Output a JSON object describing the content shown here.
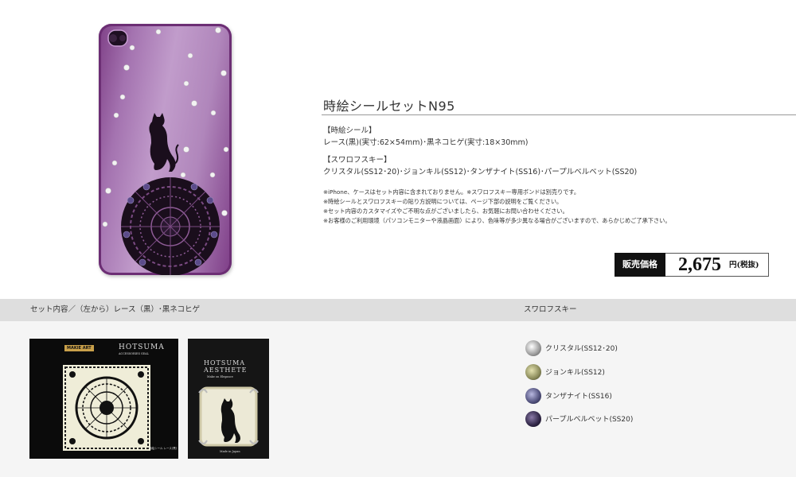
{
  "product": {
    "title": "時絵シールセットN95",
    "seal_heading": "【時絵シール】",
    "seal_detail": "レース(黒)(実寸:62×54mm)･黒ネコヒゲ(実寸:18×30mm)",
    "swarovski_heading": "【スワロフスキー】",
    "swarovski_detail": "クリスタル(SS12･20)･ジョンキル(SS12)･タンザナイト(SS16)･パープルベルベット(SS20)",
    "notes": [
      "※iPhone、ケースはセット内容に含まれておりません。※スワロフスキー専用ボンドは別売りです。",
      "※時絵シールとスワロフスキーの貼り方説明については、ページ下部の説明をご覧ください。",
      "※セット内容のカスタマイズやご不明な点がございましたら、お気軽にお問い合わせください。",
      "※お客様のご利用環境（パソコンモニターや液晶画面）により、色味等が多少異なる場合がございますので、あらかじめご了承下さい。"
    ]
  },
  "price": {
    "label": "販売価格",
    "value": "2,675",
    "unit": "円(税抜)"
  },
  "sections": {
    "set_contents": "セット内容／（左から）レース（黒）･黒ネコヒゲ",
    "swarovski": "スワロフスキー"
  },
  "packages": {
    "lace": {
      "badge": "MAKIE ART",
      "brand": "HOTSUMA",
      "sub": "ACCESSORIES SEAL",
      "footer": "時絵シール レース(黒)"
    },
    "cat": {
      "brand": "HOTSUMA",
      "brand2": "AESTHETE",
      "sub": "Make on Elegance",
      "footer": "Made in Japan"
    }
  },
  "swarovski_items": [
    {
      "label": "クリスタル(SS12･20)",
      "color": "#c9c9c9"
    },
    {
      "label": "ジョンキル(SS12)",
      "color": "#9a9a6a"
    },
    {
      "label": "タンザナイト(SS16)",
      "color": "#5a5a86"
    },
    {
      "label": "パープルベルベット(SS20)",
      "color": "#3a2e52"
    }
  ],
  "colors": {
    "case_purple": "#a473b0",
    "band_gray": "#dedede",
    "price_label_bg": "#111111"
  }
}
